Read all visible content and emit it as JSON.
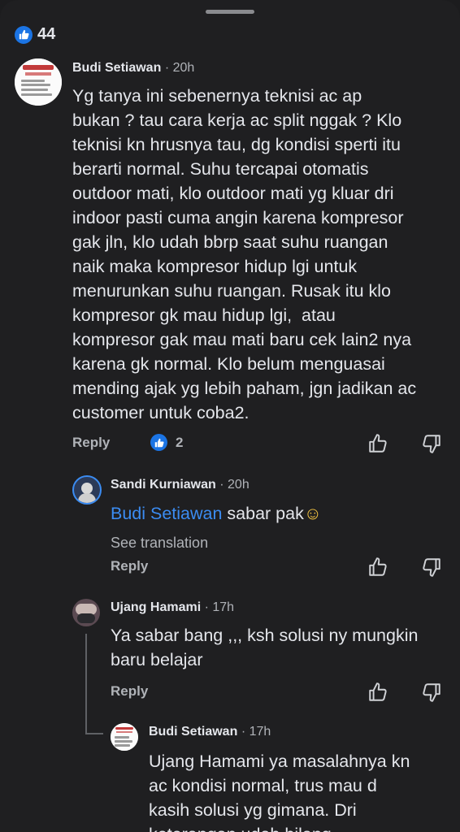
{
  "post": {
    "reaction_count": "44"
  },
  "comments": [
    {
      "author": "Budi Setiawan",
      "time": "· 20h",
      "avatar_text": [
        "BUDI SETIAW",
        "08233164157"
      ],
      "text_lines": [
        "Yg tanya ini sebenernya teknisi ac ap",
        "bukan ? tau cara kerja ac split nggak ? Klo",
        "teknisi kn hrusnya tau, dg kondisi sperti itu",
        "berarti normal. Suhu tercapai otomatis",
        "outdoor mati, klo outdoor mati yg kluar dri",
        "indoor pasti cuma angin karena kompresor",
        "gak jln, klo udah bbrp saat suhu ruangan",
        "naik maka kompresor hidup lgi untuk",
        "menurunkan suhu ruangan. Rusak itu klo",
        "kompresor gk mau hidup lgi,  atau",
        "kompresor gak mau mati baru cek lain2 nya",
        "karena gk normal. Klo belum menguasai",
        "mending ajak yg lebih paham, jgn jadikan ac",
        "customer untuk coba2."
      ],
      "reply_label": "Reply",
      "like_count": "2"
    },
    {
      "author": "Sandi Kurniawan",
      "time": "· 20h",
      "mention": "Budi Setiawan",
      "text": " sabar pak",
      "emoji": "☺",
      "see_translation": "See translation",
      "reply_label": "Reply"
    },
    {
      "author": "Ujang Hamami",
      "time": "· 17h",
      "text_lines": [
        "Ya sabar bang ,,, ksh solusi ny mungkin",
        "baru belajar"
      ],
      "reply_label": "Reply"
    },
    {
      "author": "Budi Setiawan",
      "time": "· 17h",
      "text_lines": [
        "Ujang Hamami ya masalahnya kn",
        "ac kondisi normal, trus mau d",
        "kasih solusi yg gimana. Dri",
        "keterangan udah bilang"
      ]
    }
  ],
  "icons": {
    "like": "thumbs-up-icon",
    "dislike": "thumbs-down-icon",
    "reaction": "like-reaction-icon"
  },
  "colors": {
    "background": "#1f1f21",
    "accent": "#1b74e4",
    "mention": "#3b8cf2",
    "text": "#e4e6eb",
    "muted": "#b0b3b8"
  }
}
